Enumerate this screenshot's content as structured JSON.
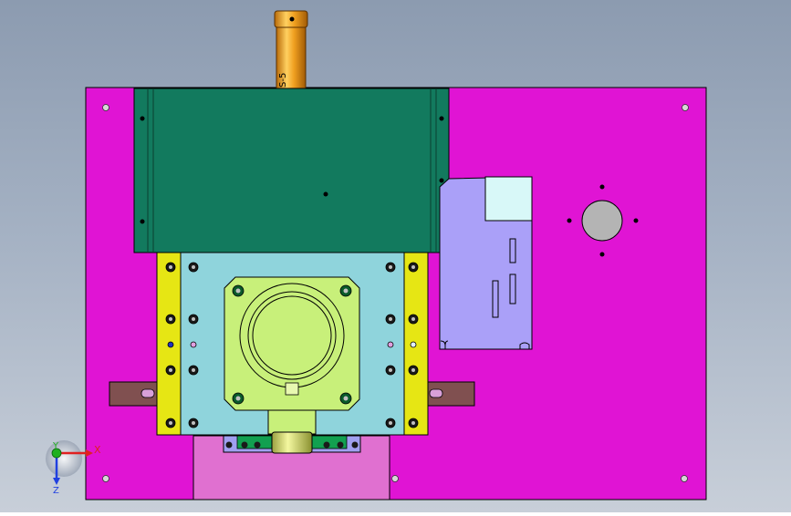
{
  "viewport": {
    "background_top": "#8c9bb0",
    "background_bottom": "#c8cfd9"
  },
  "model": {
    "part_label": "S-5",
    "colors": {
      "base_plate": "#e014d4",
      "cover": "#127a5e",
      "cylinder": "#f0a020",
      "mold_block": "#8fd4dc",
      "side_bar": "#e6e614",
      "motor": "#c8f07a",
      "controller": "#aaa0f8",
      "slider": "#805050",
      "lower_plate": "#e070d0"
    }
  },
  "triad": {
    "x_label": "X",
    "y_label": "Y",
    "z_label": "Z",
    "x_color": "#e02020",
    "y_color": "#20b020",
    "z_color": "#2040e0"
  }
}
